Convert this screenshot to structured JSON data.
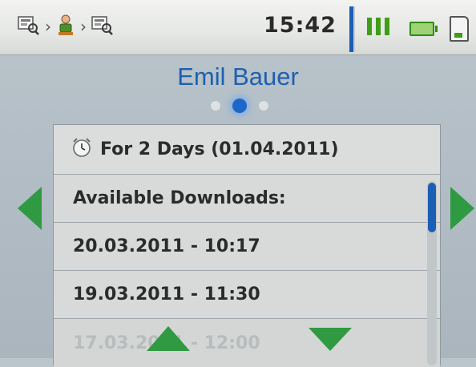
{
  "status_bar": {
    "breadcrumb": [
      {
        "icon": "device-search-icon"
      },
      {
        "icon": "person-icon"
      },
      {
        "icon": "device-search-icon"
      }
    ],
    "separator": "›",
    "time": "15:42",
    "accent_color": "#1d5eb5",
    "signal_icon": "signal-bars-icon",
    "battery_icon": "battery-icon",
    "storage_icon": "sd-card-icon"
  },
  "title": "Emil Bauer",
  "pagination": {
    "pages": 3,
    "active_index": 1
  },
  "list": {
    "header": {
      "icon": "alarm-clock-icon",
      "text": "For 2 Days (01.04.2011)"
    },
    "items": [
      "Available Downloads:",
      "20.03.2011 - 10:17",
      "19.03.2011 - 11:30",
      "17.03.2011 - 12:00"
    ]
  },
  "nav": {
    "left": "arrow-left-icon",
    "right": "arrow-right-icon",
    "up": "arrow-up-icon",
    "down": "arrow-down-icon",
    "color": "#2f9a42"
  }
}
